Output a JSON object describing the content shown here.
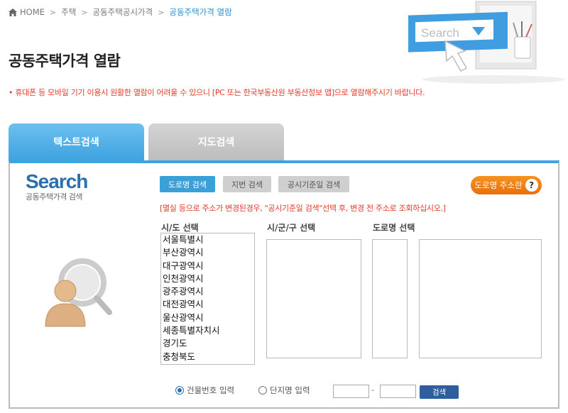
{
  "breadcrumb": {
    "home": "HOME",
    "items": [
      "주택",
      "공동주택공시가격",
      "공동주택가격 열람"
    ]
  },
  "page_title": "공동주택가격 열람",
  "notice": "• 휴대폰 등 모바일 기기 이용시 원활한 열람이 어려울 수 있으니 [PC 또는 한국부동산원 부동산정보 앱]으로 열람해주시기 바랍니다.",
  "hero": {
    "search_word": "Search"
  },
  "tabs": [
    {
      "label": "텍스트검색",
      "active": true
    },
    {
      "label": "지도검색",
      "active": false
    }
  ],
  "search_logo": {
    "title": "Search",
    "subtitle": "공동주택가격 검색"
  },
  "mode_buttons": {
    "road": "도로명 검색",
    "jibun": "지번 검색",
    "date": "공시기준일 검색"
  },
  "road_addr_button": {
    "label": "도로명 주소란",
    "help": "?"
  },
  "hint": "[멸실 등으로 주소가 변경된경우, \"공시기준일 검색\"선택 후, 변경 전 주소로 조회하십시오.]",
  "columns": {
    "sido": "시/도 선택",
    "sigungu": "시/군/구 선택",
    "road": "도로명 선택"
  },
  "sido_options": [
    "서울특별시",
    "부산광역시",
    "대구광역시",
    "인천광역시",
    "광주광역시",
    "대전광역시",
    "울산광역시",
    "세종특별자치시",
    "경기도",
    "충청북도"
  ],
  "radio": {
    "building": {
      "label": "건물번호 입력",
      "checked": true
    },
    "complex": {
      "label": "단지명 입력",
      "checked": false
    }
  },
  "number_inputs": {
    "dash": "-",
    "first": "",
    "second": ""
  },
  "search_button": "검색",
  "colors": {
    "accent": "#3fa3e0",
    "alert": "#e23a2a",
    "orange": "#f6921e",
    "navy": "#2f5e9e"
  }
}
